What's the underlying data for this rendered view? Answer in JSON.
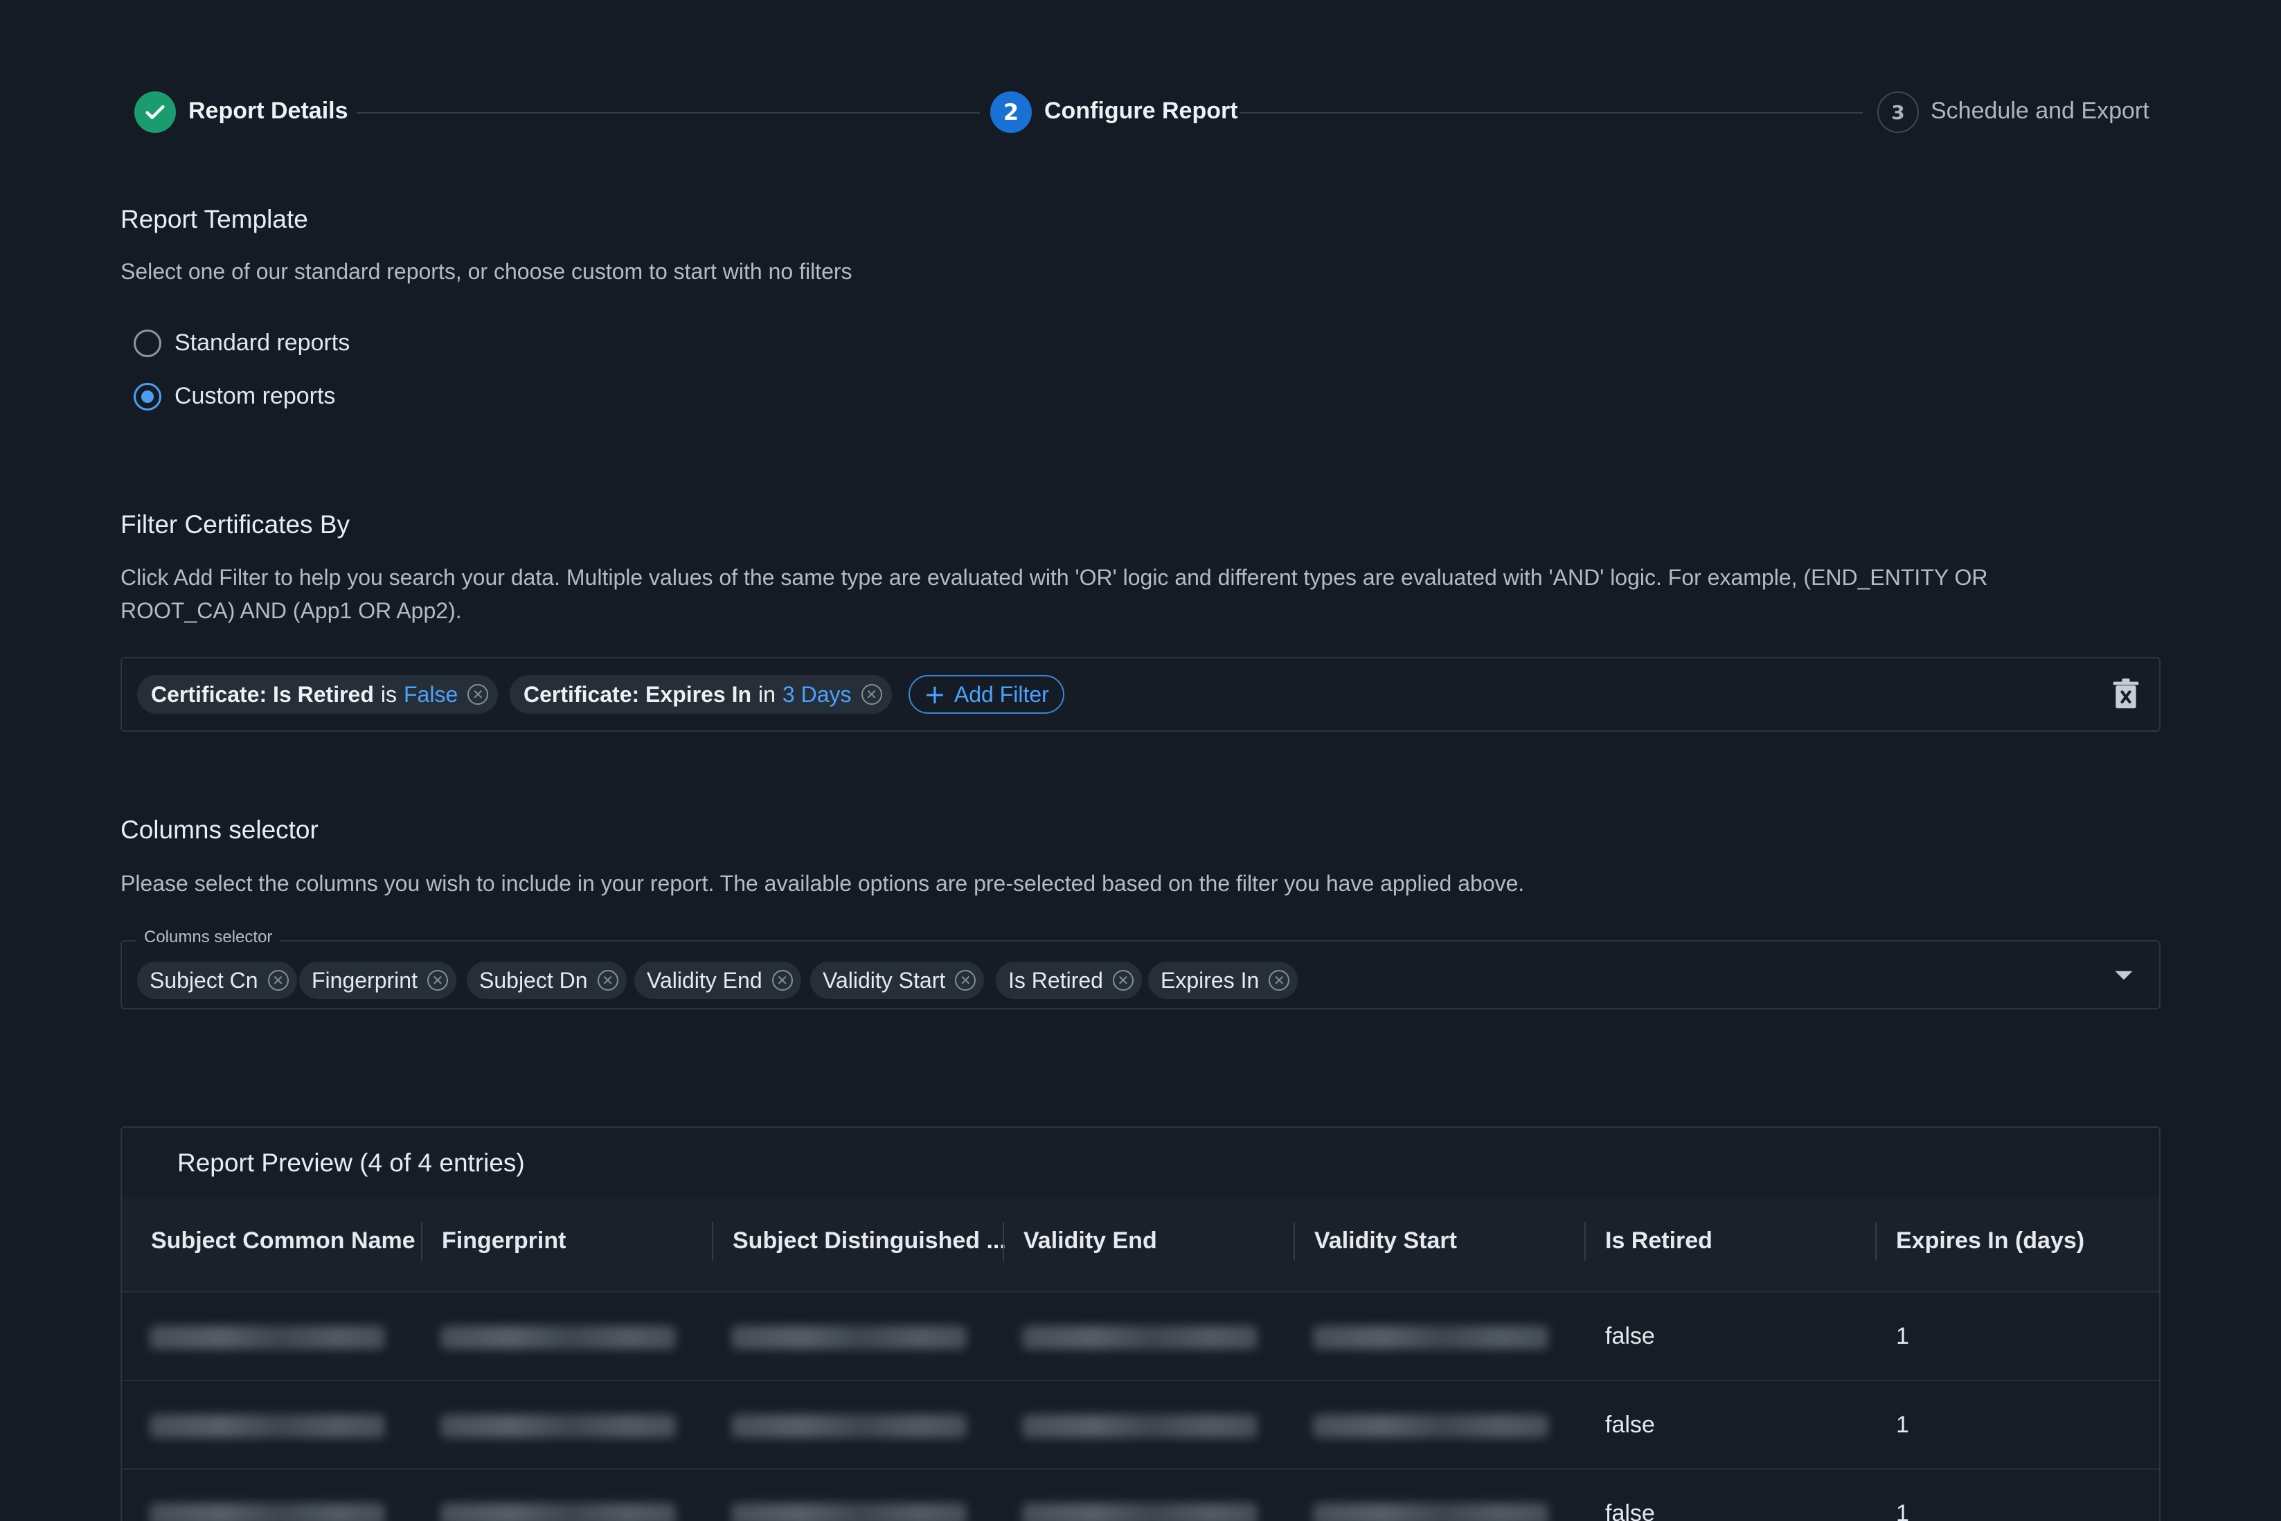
{
  "stepper": {
    "steps": [
      {
        "number": "1",
        "label": "Report Details",
        "state": "done"
      },
      {
        "number": "2",
        "label": "Configure Report",
        "state": "active"
      },
      {
        "number": "3",
        "label": "Schedule and Export",
        "state": "pending"
      }
    ]
  },
  "template": {
    "title": "Report Template",
    "description": "Select one of our standard reports, or choose custom to start with no filters",
    "options": [
      {
        "label": "Standard reports",
        "selected": false
      },
      {
        "label": "Custom reports",
        "selected": true
      }
    ]
  },
  "filter": {
    "title": "Filter Certificates By",
    "description_line1": "Click Add Filter to help you search your data. Multiple values of the same type are evaluated with 'OR' logic and different types are evaluated with 'AND' logic. For example, (END_ENTITY OR",
    "description_line2": "ROOT_CA) AND (App1 OR App2).",
    "chips": [
      {
        "field": "Certificate: Is Retired",
        "operator": "is",
        "value": "False"
      },
      {
        "field": "Certificate: Expires In",
        "operator": "in",
        "value": "3 Days"
      }
    ],
    "add_label": "Add Filter"
  },
  "columns": {
    "title": "Columns selector",
    "description": "Please select the columns you wish to include in your report. The available options are pre-selected based on the filter you have applied above.",
    "field_label": "Columns selector",
    "chips": [
      "Subject Cn",
      "Fingerprint",
      "Subject Dn",
      "Validity End",
      "Validity Start",
      "Is Retired",
      "Expires In"
    ]
  },
  "preview": {
    "title": "Report Preview (4 of 4 entries)",
    "headers": [
      "Subject Common Name",
      "Fingerprint",
      "Subject Distinguished ...",
      "Validity End",
      "Validity Start",
      "Is Retired",
      "Expires In (days)"
    ],
    "rows": [
      {
        "is_retired": "false",
        "expires_in": "1"
      },
      {
        "is_retired": "false",
        "expires_in": "1"
      },
      {
        "is_retired": "false",
        "expires_in": "1"
      }
    ]
  },
  "colors": {
    "accent": "#4aa3ff",
    "success": "#1a9c6f",
    "background": "#141b24"
  }
}
